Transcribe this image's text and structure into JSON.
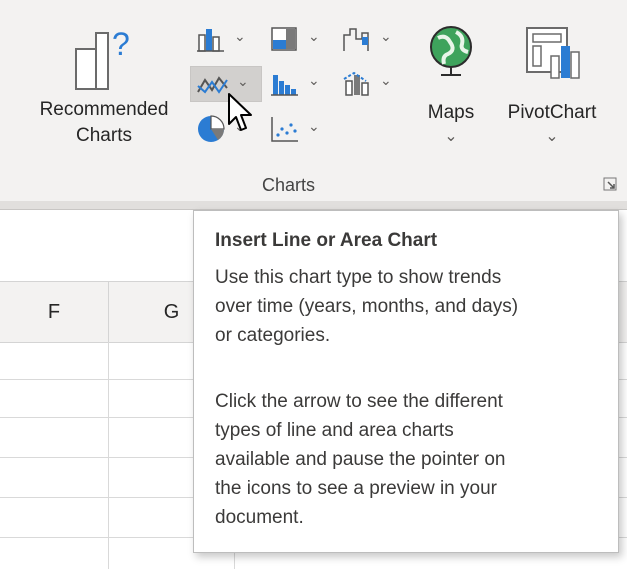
{
  "ribbon": {
    "recommended_charts": {
      "line1": "Recommended",
      "line2": "Charts"
    },
    "maps": {
      "label": "Maps",
      "dropdown": "⌄"
    },
    "pivotchart": {
      "label": "PivotChart",
      "dropdown": "⌄"
    },
    "group_label": "Charts",
    "hovered_button": "insert-line-or-area-chart",
    "icons": [
      "column-chart-icon",
      "hierarchy-chart-icon",
      "waterfall-chart-icon",
      "line-area-chart-icon",
      "statistic-chart-icon",
      "combo-chart-icon",
      "pie-chart-icon",
      "scatter-chart-icon",
      "globe-icon",
      "pivotchart-icon",
      "recommended-charts-icon",
      "dialog-launcher-icon",
      "pointer-cursor-icon"
    ]
  },
  "sheet": {
    "columns": [
      "F",
      "G"
    ]
  },
  "tooltip": {
    "title": "Insert Line or Area Chart",
    "para1": "Use this chart type to show trends\nover time (years, months, and days)\nor categories.",
    "para2": "Click the arrow to see the different\ntypes of line and area charts\navailable and pause the pointer on\nthe icons to see a preview in your\ndocument."
  },
  "colors": {
    "ribbon_bg": "#f3f2f1",
    "excel_green": "#217346",
    "chart_blue": "#2b7cd3",
    "hover_bg": "#d2d0ce"
  }
}
